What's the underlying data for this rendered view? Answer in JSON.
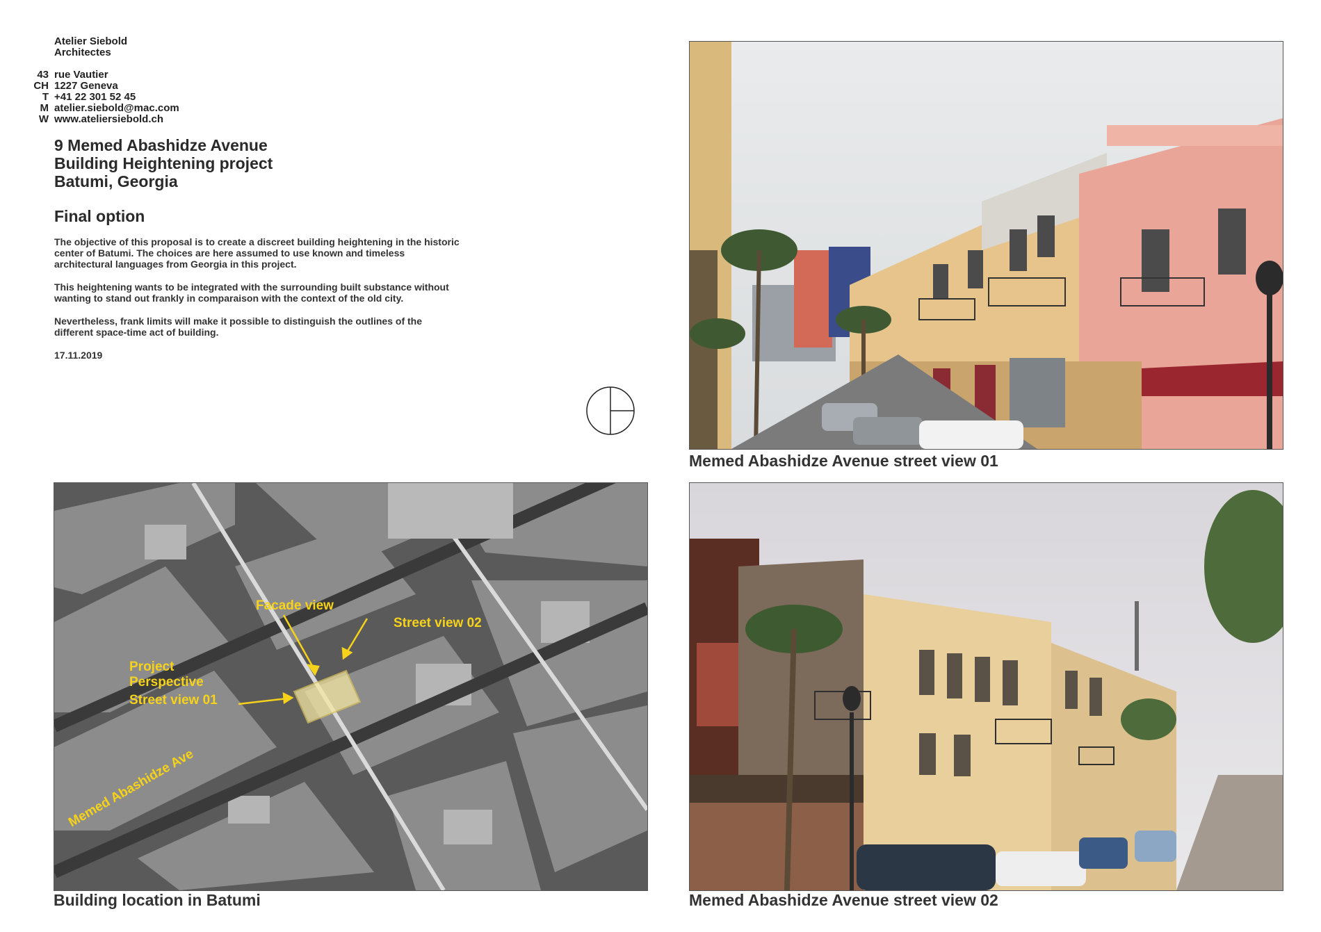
{
  "firm": {
    "line1": "Atelier Siebold",
    "line2": "Architectes"
  },
  "address": [
    {
      "key": "43",
      "value": "rue Vautier"
    },
    {
      "key": "CH",
      "value": "1227 Geneva"
    },
    {
      "key": "T",
      "value": "+41 22 301 52 45"
    },
    {
      "key": "M",
      "value": "atelier.siebold@mac.com"
    },
    {
      "key": "W",
      "value": "www.ateliersiebold.ch"
    }
  ],
  "project": {
    "line1": "9 Memed Abashidze Avenue",
    "line2": "Building Heightening project",
    "line3": "Batumi, Georgia"
  },
  "section_title": "Final option",
  "paragraphs": {
    "p1_line1": "The objective of this proposal is to create a discreet building heightening in the historic",
    "p1_line2": "center of Batumi. The choices are here assumed to use known and timeless",
    "p1_line3": "architectural languages from Georgia in this project.",
    "p2_line1": "This heightening wants to be integrated with the surrounding built substance without",
    "p2_line2": "wanting to stand out frankly in comparaison with the context of the old city.",
    "p3_line1": "Nevertheless, frank limits will make it possible to distinguish the outlines of the",
    "p3_line2": "different space-time act of building."
  },
  "date": "17.11.2019",
  "captions": {
    "street_view_01": "Memed Abashidze Avenue street view 01",
    "location": "Building location in Batumi",
    "street_view_02": "Memed Abashidze Avenue street view 02"
  },
  "map_labels": {
    "facade_view": "Facade view",
    "street_view_02": "Street view 02",
    "project": "Project",
    "perspective": "Perspective",
    "street_view_01": "Street view 01",
    "avenue": "Memed Abashidze Ave"
  },
  "colors": {
    "annotation_yellow": "#f6d21a",
    "text_dark": "#2a2a2a"
  },
  "icons": {
    "north_arrow": "north-arrow-icon"
  }
}
